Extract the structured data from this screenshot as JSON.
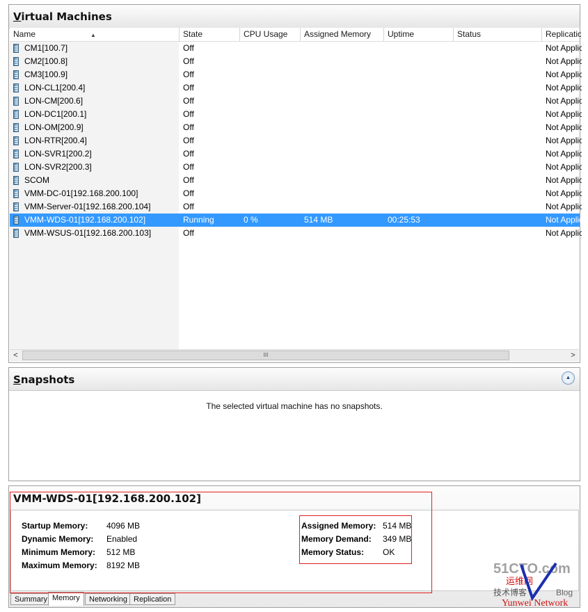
{
  "vm_pane": {
    "title_first": "V",
    "title_rest": "irtual Machines",
    "columns": [
      "Name",
      "State",
      "CPU Usage",
      "Assigned Memory",
      "Uptime",
      "Status",
      "Replication"
    ],
    "rows": [
      {
        "name": "CM1[100.7]",
        "state": "Off",
        "cpu": "",
        "mem": "",
        "uptime": "",
        "status": "",
        "repl": "Not Applicable"
      },
      {
        "name": "CM2[100.8]",
        "state": "Off",
        "cpu": "",
        "mem": "",
        "uptime": "",
        "status": "",
        "repl": "Not Applicable"
      },
      {
        "name": "CM3[100.9]",
        "state": "Off",
        "cpu": "",
        "mem": "",
        "uptime": "",
        "status": "",
        "repl": "Not Applicable"
      },
      {
        "name": "LON-CL1[200.4]",
        "state": "Off",
        "cpu": "",
        "mem": "",
        "uptime": "",
        "status": "",
        "repl": "Not Applicable"
      },
      {
        "name": "LON-CM[200.6]",
        "state": "Off",
        "cpu": "",
        "mem": "",
        "uptime": "",
        "status": "",
        "repl": "Not Applicable"
      },
      {
        "name": "LON-DC1[200.1]",
        "state": "Off",
        "cpu": "",
        "mem": "",
        "uptime": "",
        "status": "",
        "repl": "Not Applicable"
      },
      {
        "name": "LON-OM[200.9]",
        "state": "Off",
        "cpu": "",
        "mem": "",
        "uptime": "",
        "status": "",
        "repl": "Not Applicable"
      },
      {
        "name": "LON-RTR[200.4]",
        "state": "Off",
        "cpu": "",
        "mem": "",
        "uptime": "",
        "status": "",
        "repl": "Not Applicable"
      },
      {
        "name": "LON-SVR1[200.2]",
        "state": "Off",
        "cpu": "",
        "mem": "",
        "uptime": "",
        "status": "",
        "repl": "Not Applicable"
      },
      {
        "name": "LON-SVR2[200.3]",
        "state": "Off",
        "cpu": "",
        "mem": "",
        "uptime": "",
        "status": "",
        "repl": "Not Applicable"
      },
      {
        "name": "SCOM",
        "state": "Off",
        "cpu": "",
        "mem": "",
        "uptime": "",
        "status": "",
        "repl": "Not Applicable"
      },
      {
        "name": "VMM-DC-01[192.168.200.100]",
        "state": "Off",
        "cpu": "",
        "mem": "",
        "uptime": "",
        "status": "",
        "repl": "Not Applicable"
      },
      {
        "name": "VMM-Server-01[192.168.200.104]",
        "state": "Off",
        "cpu": "",
        "mem": "",
        "uptime": "",
        "status": "",
        "repl": "Not Applicable"
      },
      {
        "name": "VMM-WDS-01[192.168.200.102]",
        "state": "Running",
        "cpu": "0 %",
        "mem": "514 MB",
        "uptime": "00:25:53",
        "status": "",
        "repl": "Not Applicable",
        "selected": true
      },
      {
        "name": "VMM-WSUS-01[192.168.200.103]",
        "state": "Off",
        "cpu": "",
        "mem": "",
        "uptime": "",
        "status": "",
        "repl": "Not Applicable"
      }
    ],
    "scroll_left": "<",
    "scroll_right": ">",
    "scroll_grip": "III"
  },
  "snapshots": {
    "title_first": "S",
    "title_rest": "napshots",
    "message": "The selected virtual machine has no snapshots.",
    "collapse_glyph": "▲"
  },
  "details": {
    "title": "VMM-WDS-01[192.168.200.102]",
    "left": [
      {
        "label": "Startup Memory:",
        "value": "4096 MB"
      },
      {
        "label": "Dynamic Memory:",
        "value": "Enabled"
      },
      {
        "label": "Minimum Memory:",
        "value": "512 MB"
      },
      {
        "label": "Maximum Memory:",
        "value": "8192 MB"
      }
    ],
    "right": [
      {
        "label": "Assigned Memory:",
        "value": "514 MB"
      },
      {
        "label": "Memory Demand:",
        "value": "349 MB"
      },
      {
        "label": "Memory Status:",
        "value": "OK"
      }
    ],
    "tabs": [
      "Summary",
      "Memory",
      "Networking",
      "Replication"
    ],
    "active_tab": "Memory"
  },
  "watermark": {
    "line1": "51CTO.com",
    "line2": "运维网",
    "line3": "技术博客",
    "line4": "Blog",
    "line5": "Yunwei Network"
  },
  "colors": {
    "selection": "#3399ff",
    "highlight_box": "#e02020"
  }
}
